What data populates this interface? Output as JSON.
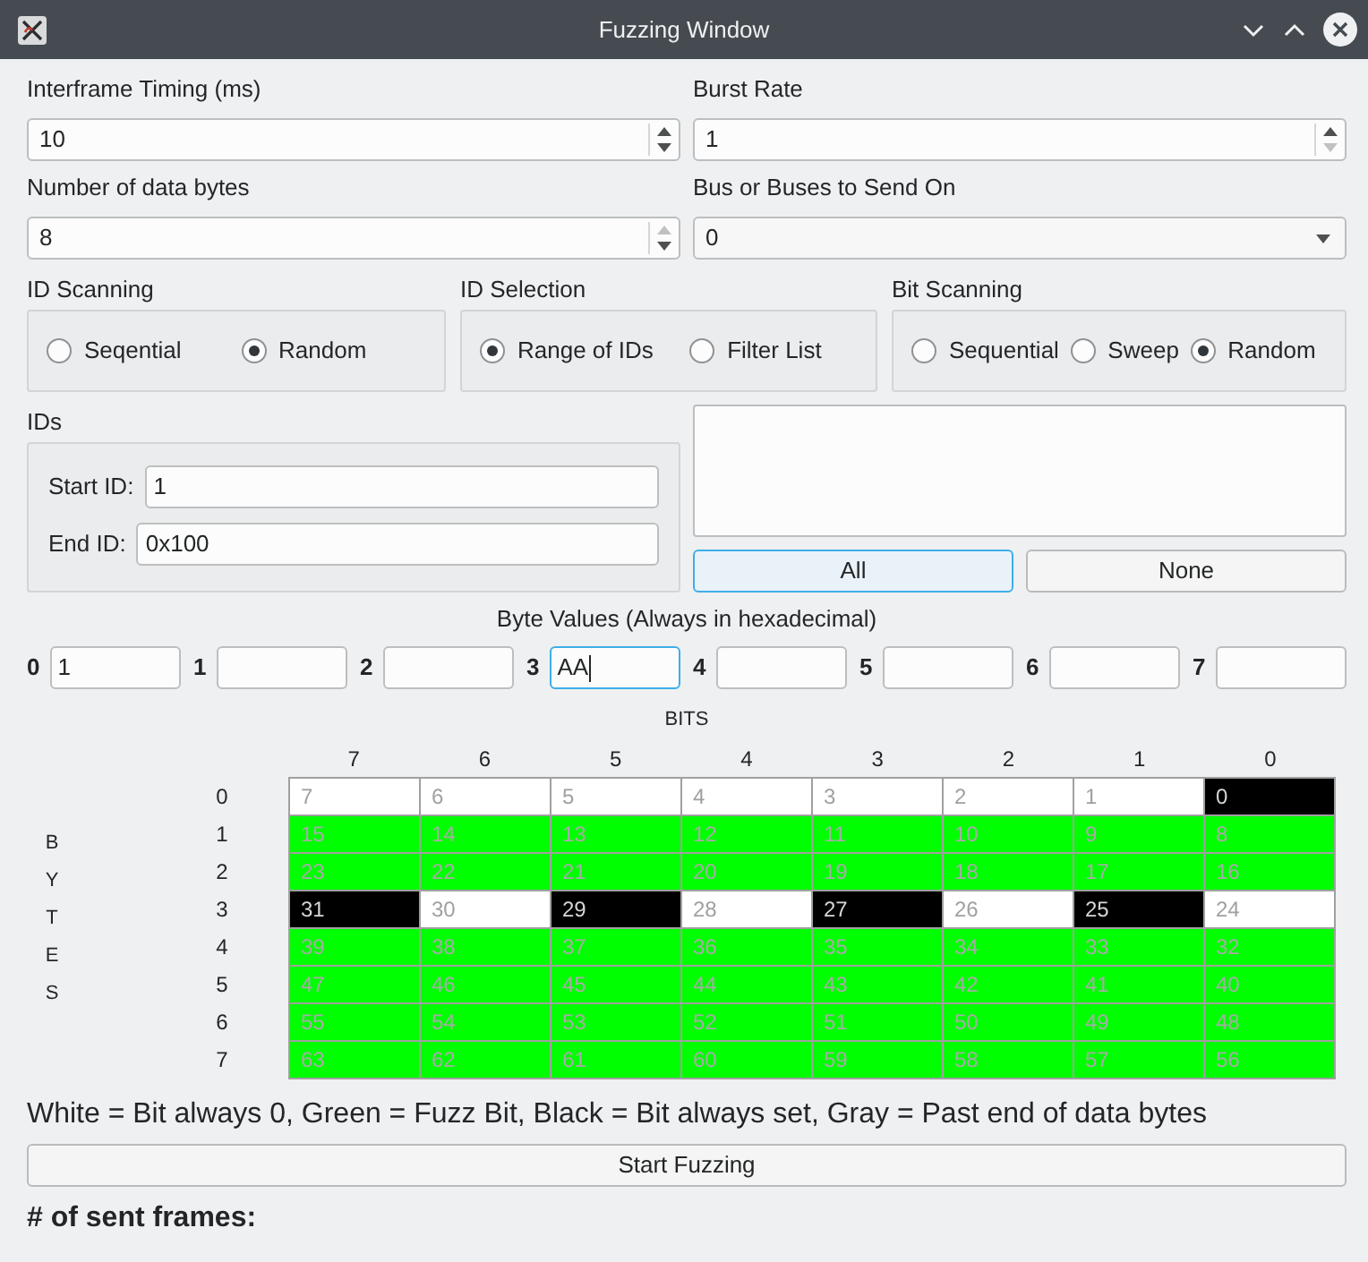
{
  "window": {
    "title": "Fuzzing Window"
  },
  "settings": [
    {
      "kind": "spin",
      "label": "Interframe Timing (ms)",
      "value": "10",
      "can_increase": true,
      "can_decrease": true
    },
    {
      "kind": "spin",
      "label": "Burst Rate",
      "value": "1",
      "can_increase": true,
      "can_decrease": false
    },
    {
      "kind": "spin",
      "label": "Number of data bytes",
      "value": "8",
      "can_increase": false,
      "can_decrease": true
    },
    {
      "kind": "combo",
      "label": "Bus or Buses to Send On",
      "value": "0"
    }
  ],
  "option_groups": [
    {
      "title": "ID Scanning",
      "options": [
        {
          "label": "Seqential",
          "selected": false
        },
        {
          "label": "Random",
          "selected": true
        }
      ]
    },
    {
      "title": "ID Selection",
      "options": [
        {
          "label": "Range of IDs",
          "selected": true
        },
        {
          "label": "Filter List",
          "selected": false
        }
      ]
    },
    {
      "title": "Bit Scanning",
      "options": [
        {
          "label": "Sequential",
          "selected": false
        },
        {
          "label": "Sweep",
          "selected": false
        },
        {
          "label": "Random",
          "selected": true
        }
      ]
    }
  ],
  "ids": {
    "title": "IDs",
    "fields": [
      {
        "label": "Start ID:",
        "value": "1"
      },
      {
        "label": "End ID:",
        "value": "0x100"
      }
    ]
  },
  "filter_buttons": [
    {
      "label": "All",
      "focused": true
    },
    {
      "label": "None",
      "focused": false
    }
  ],
  "byte_values": {
    "title": "Byte Values (Always in hexadecimal)",
    "fields": [
      {
        "index": "0",
        "value": "1",
        "focused": false
      },
      {
        "index": "1",
        "focused": false
      },
      {
        "index": "2",
        "focused": false
      },
      {
        "index": "3",
        "value": "AA",
        "focused": true
      },
      {
        "index": "4",
        "focused": false
      },
      {
        "index": "5",
        "focused": false
      },
      {
        "index": "6",
        "focused": false
      },
      {
        "index": "7",
        "focused": false
      }
    ]
  },
  "bit_grid": {
    "column_title": "BITS",
    "row_title": "BYTES",
    "columns": [
      "7",
      "6",
      "5",
      "4",
      "3",
      "2",
      "1",
      "0"
    ],
    "rows": [
      {
        "label": "0",
        "cells": [
          {
            "text": "7",
            "kind": "zero"
          },
          {
            "text": "6",
            "kind": "zero"
          },
          {
            "text": "5",
            "kind": "zero"
          },
          {
            "text": "4",
            "kind": "zero"
          },
          {
            "text": "3",
            "kind": "zero"
          },
          {
            "text": "2",
            "kind": "zero"
          },
          {
            "text": "1",
            "kind": "zero"
          },
          {
            "text": "0",
            "kind": "set"
          }
        ]
      },
      {
        "label": "1",
        "cells": [
          {
            "text": "15",
            "kind": "fuzz"
          },
          {
            "text": "14",
            "kind": "fuzz"
          },
          {
            "text": "13",
            "kind": "fuzz"
          },
          {
            "text": "12",
            "kind": "fuzz"
          },
          {
            "text": "11",
            "kind": "fuzz"
          },
          {
            "text": "10",
            "kind": "fuzz"
          },
          {
            "text": "9",
            "kind": "fuzz"
          },
          {
            "text": "8",
            "kind": "fuzz"
          }
        ]
      },
      {
        "label": "2",
        "cells": [
          {
            "text": "23",
            "kind": "fuzz"
          },
          {
            "text": "22",
            "kind": "fuzz"
          },
          {
            "text": "21",
            "kind": "fuzz"
          },
          {
            "text": "20",
            "kind": "fuzz"
          },
          {
            "text": "19",
            "kind": "fuzz"
          },
          {
            "text": "18",
            "kind": "fuzz"
          },
          {
            "text": "17",
            "kind": "fuzz"
          },
          {
            "text": "16",
            "kind": "fuzz"
          }
        ]
      },
      {
        "label": "3",
        "cells": [
          {
            "text": "31",
            "kind": "set"
          },
          {
            "text": "30",
            "kind": "zero"
          },
          {
            "text": "29",
            "kind": "set"
          },
          {
            "text": "28",
            "kind": "zero"
          },
          {
            "text": "27",
            "kind": "set"
          },
          {
            "text": "26",
            "kind": "zero"
          },
          {
            "text": "25",
            "kind": "set"
          },
          {
            "text": "24",
            "kind": "zero"
          }
        ]
      },
      {
        "label": "4",
        "cells": [
          {
            "text": "39",
            "kind": "fuzz"
          },
          {
            "text": "38",
            "kind": "fuzz"
          },
          {
            "text": "37",
            "kind": "fuzz"
          },
          {
            "text": "36",
            "kind": "fuzz"
          },
          {
            "text": "35",
            "kind": "fuzz"
          },
          {
            "text": "34",
            "kind": "fuzz"
          },
          {
            "text": "33",
            "kind": "fuzz"
          },
          {
            "text": "32",
            "kind": "fuzz"
          }
        ]
      },
      {
        "label": "5",
        "cells": [
          {
            "text": "47",
            "kind": "fuzz"
          },
          {
            "text": "46",
            "kind": "fuzz"
          },
          {
            "text": "45",
            "kind": "fuzz"
          },
          {
            "text": "44",
            "kind": "fuzz"
          },
          {
            "text": "43",
            "kind": "fuzz"
          },
          {
            "text": "42",
            "kind": "fuzz"
          },
          {
            "text": "41",
            "kind": "fuzz"
          },
          {
            "text": "40",
            "kind": "fuzz"
          }
        ]
      },
      {
        "label": "6",
        "cells": [
          {
            "text": "55",
            "kind": "fuzz"
          },
          {
            "text": "54",
            "kind": "fuzz"
          },
          {
            "text": "53",
            "kind": "fuzz"
          },
          {
            "text": "52",
            "kind": "fuzz"
          },
          {
            "text": "51",
            "kind": "fuzz"
          },
          {
            "text": "50",
            "kind": "fuzz"
          },
          {
            "text": "49",
            "kind": "fuzz"
          },
          {
            "text": "48",
            "kind": "fuzz"
          }
        ]
      },
      {
        "label": "7",
        "cells": [
          {
            "text": "63",
            "kind": "fuzz"
          },
          {
            "text": "62",
            "kind": "fuzz"
          },
          {
            "text": "61",
            "kind": "fuzz"
          },
          {
            "text": "60",
            "kind": "fuzz"
          },
          {
            "text": "59",
            "kind": "fuzz"
          },
          {
            "text": "58",
            "kind": "fuzz"
          },
          {
            "text": "57",
            "kind": "fuzz"
          },
          {
            "text": "56",
            "kind": "fuzz"
          }
        ]
      }
    ]
  },
  "legend": "White = Bit always 0, Green = Fuzz Bit, Black = Bit always set, Gray = Past end of data bytes",
  "start_button": {
    "label": "Start Fuzzing"
  },
  "sent_frames": {
    "label": "# of sent frames:"
  }
}
